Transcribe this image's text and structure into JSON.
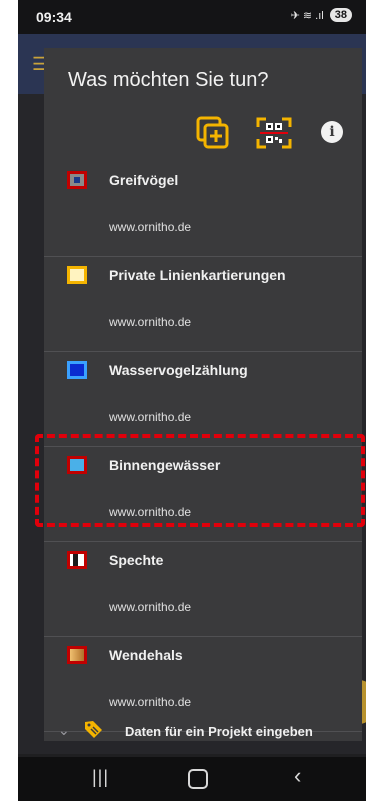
{
  "status_bar": {
    "time": "09:34",
    "signal": "✈ ≋ .ıl",
    "battery": "38"
  },
  "dialog": {
    "title": "Was möchten Sie tun?",
    "actions": [
      {
        "name": "add-copy-icon"
      },
      {
        "name": "qr-scanner-icon"
      },
      {
        "name": "info-icon",
        "glyph": "i"
      }
    ],
    "items": [
      {
        "title": "Greifvögel",
        "url": "www.ornitho.de",
        "icon": "greifvoegel-icon",
        "colors": {
          "border": "#c00000",
          "fill": "#8a8a8a",
          "center": "#1a3a8a"
        }
      },
      {
        "title": "Private Linienkartierungen",
        "url": "www.ornitho.de",
        "icon": "linienkartierungen-icon",
        "colors": {
          "border": "#f4b400",
          "fill": "#fff3c0"
        }
      },
      {
        "title": "Wasservogelzählung",
        "url": "www.ornitho.de",
        "icon": "wasservogel-icon",
        "colors": {
          "border": "#3aa0ff",
          "fill": "#0a2ad0"
        }
      },
      {
        "title": "Binnengewässer",
        "url": "www.ornitho.de",
        "icon": "binnengewaesser-icon",
        "colors": {
          "border": "#c00000",
          "fill": "#4ab0e8"
        }
      },
      {
        "title": "Spechte",
        "url": "www.ornitho.de",
        "icon": "spechte-icon",
        "colors": {
          "border": "#c00000",
          "fill": "#ffffff"
        }
      },
      {
        "title": "Wendehals",
        "url": "www.ornitho.de",
        "icon": "wendehals-icon",
        "colors": {
          "border": "#c00000",
          "fill": "#c88a3a"
        }
      }
    ],
    "project_row": {
      "label": "Daten für ein Projekt eingeben",
      "chevron": "⌄"
    }
  },
  "navbar": {
    "recent": "|||",
    "back": "‹"
  },
  "colors": {
    "accent": "#f4b400",
    "highlight": "#e0000b",
    "dialog_bg": "#3a3a3c"
  }
}
